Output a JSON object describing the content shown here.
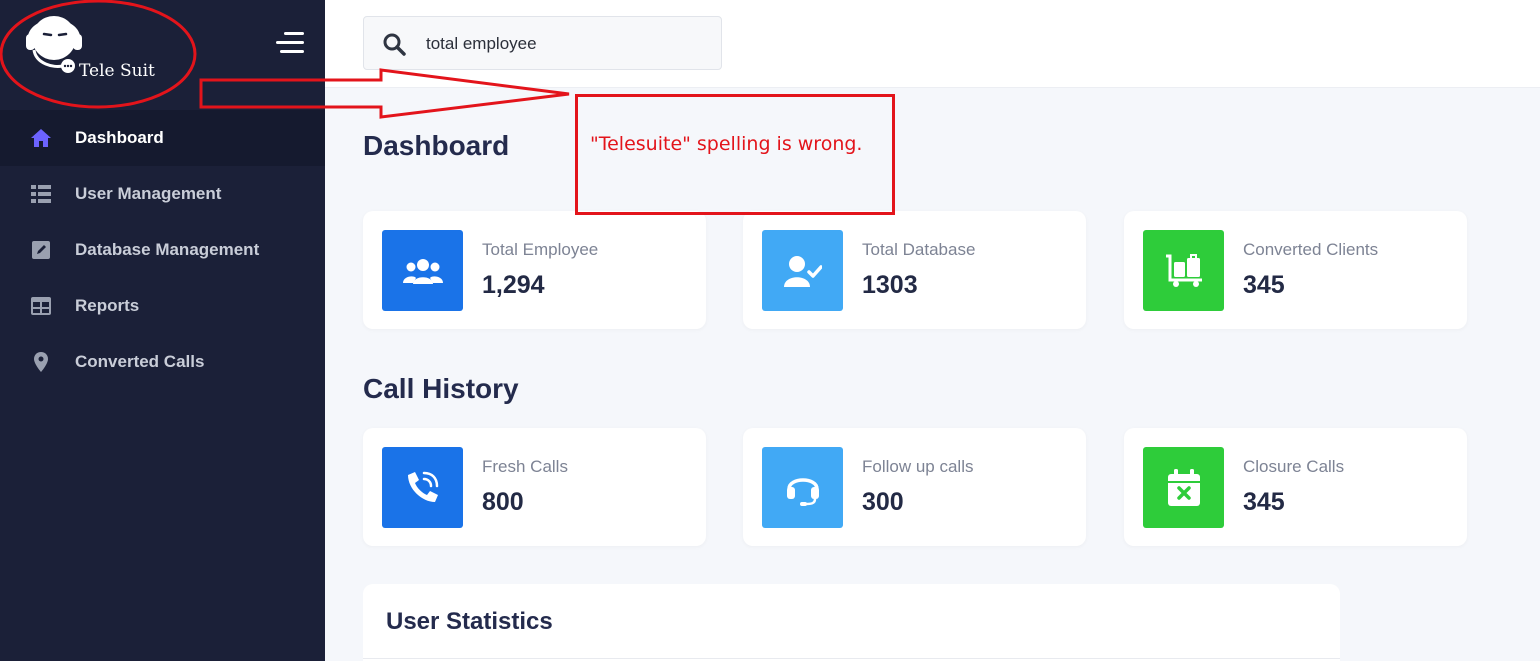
{
  "app": {
    "logo_text": "Tele Suit",
    "menu_icon": "hamburger-menu-icon"
  },
  "sidebar": {
    "items": [
      {
        "label": "Dashboard",
        "icon": "home-icon",
        "active": true
      },
      {
        "label": "User Management",
        "icon": "list-icon"
      },
      {
        "label": "Database Management",
        "icon": "edit-icon"
      },
      {
        "label": "Reports",
        "icon": "table-icon"
      },
      {
        "label": "Converted Calls",
        "icon": "location-pin-icon"
      }
    ]
  },
  "search": {
    "value": "total employee",
    "icon": "search-icon"
  },
  "main": {
    "dashboard_title": "Dashboard",
    "call_history_title": "Call History",
    "user_statistics_title": "User Statistics",
    "summary_cards": [
      {
        "label": "Total Employee",
        "value": "1,294",
        "icon": "users-icon",
        "color": "#1a73e8"
      },
      {
        "label": "Total Database",
        "value": "1303",
        "icon": "user-check-icon",
        "color": "#41a9f5"
      },
      {
        "label": "Converted Clients",
        "value": "345",
        "icon": "luggage-cart-icon",
        "color": "#2ecc3a"
      }
    ],
    "call_cards": [
      {
        "label": "Fresh Calls",
        "value": "800",
        "icon": "phone-volume-icon",
        "color": "#1a73e8"
      },
      {
        "label": "Follow up calls",
        "value": "300",
        "icon": "headset-icon",
        "color": "#41a9f5"
      },
      {
        "label": "Closure Calls",
        "value": "345",
        "icon": "calendar-x-icon",
        "color": "#2ecc3a"
      }
    ]
  },
  "annotation": {
    "note": "\"Telesuite\" spelling is wrong.",
    "color": "#e3141b"
  },
  "colors": {
    "sidebar_bg": "#1b2038",
    "active_icon": "#6c63ff",
    "page_bg": "#f5f7fb"
  }
}
